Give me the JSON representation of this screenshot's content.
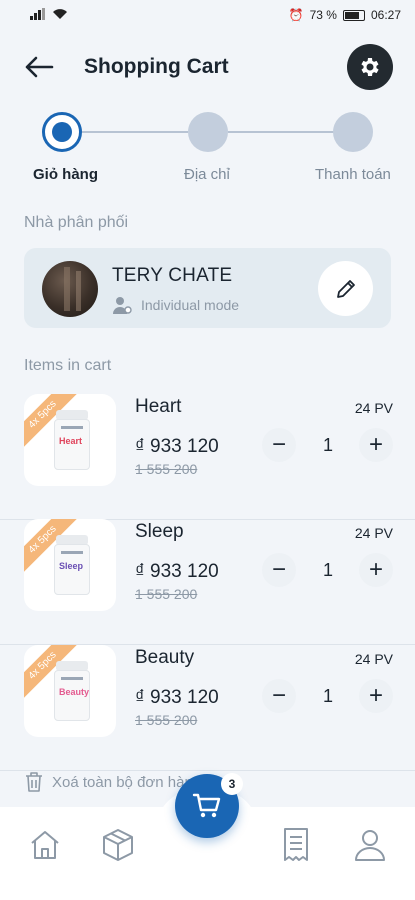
{
  "status_bar": {
    "battery": "73 %",
    "time": "06:27"
  },
  "header": {
    "title": "Shopping Cart"
  },
  "steps": [
    {
      "label": "Giỏ hàng",
      "active": true
    },
    {
      "label": "Địa chỉ",
      "active": false
    },
    {
      "label": "Thanh toán",
      "active": false
    }
  ],
  "distributor": {
    "section_label": "Nhà phân phối",
    "name": "TERY CHATE",
    "mode": "Individual mode"
  },
  "cart": {
    "section_label": "Items in cart",
    "items": [
      {
        "name": "Heart",
        "pv": "24 PV",
        "price": "₫ 933 120",
        "old_price": "1 555 200",
        "qty": "1",
        "ribbon": "4x 5pcs",
        "label_color": "#e0445c"
      },
      {
        "name": "Sleep",
        "pv": "24 PV",
        "price": "₫ 933 120",
        "old_price": "1 555 200",
        "qty": "1",
        "ribbon": "4x 5pcs",
        "label_color": "#6a4fb3"
      },
      {
        "name": "Beauty",
        "pv": "24 PV",
        "price": "₫ 933 120",
        "old_price": "1 555 200",
        "qty": "1",
        "ribbon": "4x 5pcs",
        "label_color": "#e35a8f"
      }
    ],
    "clear_all": "Xoá toàn bộ đơn hàng",
    "badge_count": "3"
  },
  "bottom_nav": {
    "items": [
      "home-icon",
      "box-icon",
      "cart-icon",
      "receipt-icon",
      "user-icon"
    ]
  },
  "colors": {
    "primary": "#1a66b4",
    "accent": "#f5b77a",
    "background": "#f2f5f9"
  }
}
